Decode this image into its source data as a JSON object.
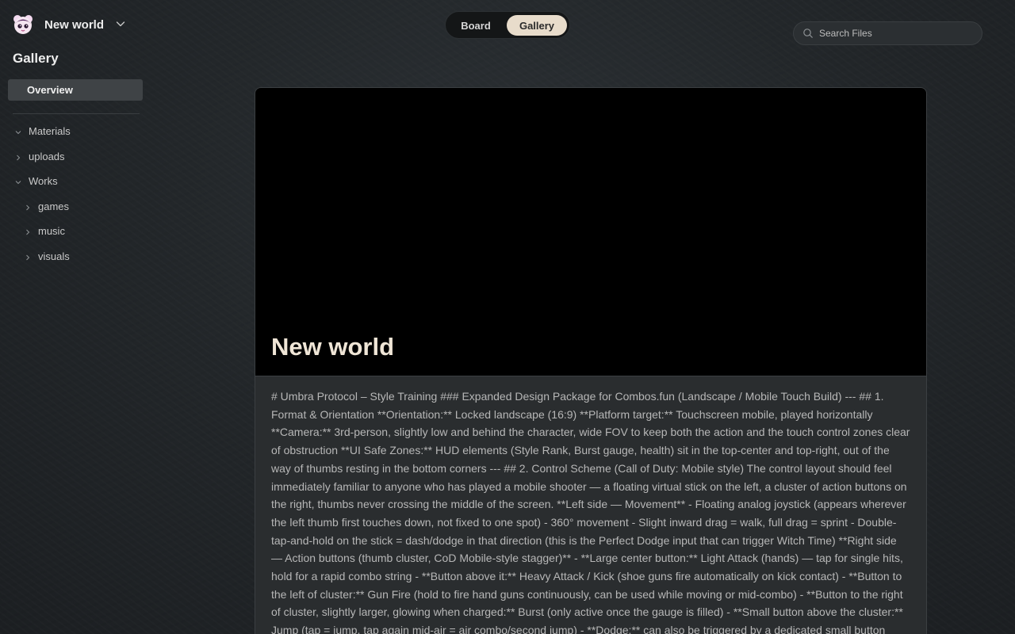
{
  "workspace": {
    "name": "New world",
    "logo_icon": "avatar-logo-icon",
    "chevron_icon": "chevron-down-icon"
  },
  "sidebar": {
    "title": "Gallery",
    "overview_label": "Overview",
    "tree": [
      {
        "label": "Materials",
        "expanded": true,
        "depth": 0
      },
      {
        "label": "uploads",
        "expanded": false,
        "depth": 0
      },
      {
        "label": "Works",
        "expanded": true,
        "depth": 0
      },
      {
        "label": "games",
        "expanded": false,
        "depth": 1
      },
      {
        "label": "music",
        "expanded": false,
        "depth": 1
      },
      {
        "label": "visuals",
        "expanded": false,
        "depth": 1
      }
    ]
  },
  "view_toggle": {
    "board_label": "Board",
    "gallery_label": "Gallery",
    "active": "Gallery"
  },
  "search": {
    "placeholder": "Search Files",
    "value": ""
  },
  "card": {
    "title": "New world",
    "description": "# Umbra Protocol – Style Training ### Expanded Design Package for Combos.fun (Landscape / Mobile Touch Build) --- ## 1. Format & Orientation **Orientation:** Locked landscape (16:9) **Platform target:** Touchscreen mobile, played horizontally **Camera:** 3rd-person, slightly low and behind the character, wide FOV to keep both the action and the touch control zones clear of obstruction **UI Safe Zones:** HUD elements (Style Rank, Burst gauge, health) sit in the top-center and top-right, out of the way of thumbs resting in the bottom corners --- ## 2. Control Scheme (Call of Duty: Mobile style) The control layout should feel immediately familiar to anyone who has played a mobile shooter — a floating virtual stick on the left, a cluster of action buttons on the right, thumbs never crossing the middle of the screen. **Left side — Movement** - Floating analog joystick (appears wherever the left thumb first touches down, not fixed to one spot) - 360° movement - Slight inward drag = walk, full drag = sprint - Double-tap-and-hold on the stick = dash/dodge in that direction (this is the Perfect Dodge input that can trigger Witch Time) **Right side — Action buttons (thumb cluster, CoD Mobile-style stagger)** - **Large center button:** Light Attack (hands) — tap for single hits, hold for a rapid combo string - **Button above it:** Heavy Attack / Kick (shoe guns fire automatically on kick contact) - **Button to the left of cluster:** Gun Fire (hold to fire hand guns continuously, can be used while moving or mid-combo) - **Button to the right of cluster, slightly larger, glowing when charged:** Burst (only active once the gauge is filled) - **Small button above the cluster:** Jump (tap = jump, tap again mid-air = air combo/second jump) - **Dodge:** can also be triggered by a dedicated small button bottom-right corner, in addition to the joystick"
  },
  "colors": {
    "background": "#23272a",
    "accent_toggle": "#e8dccb",
    "title_text": "#efe5d6",
    "hero_bg": "#000000"
  }
}
